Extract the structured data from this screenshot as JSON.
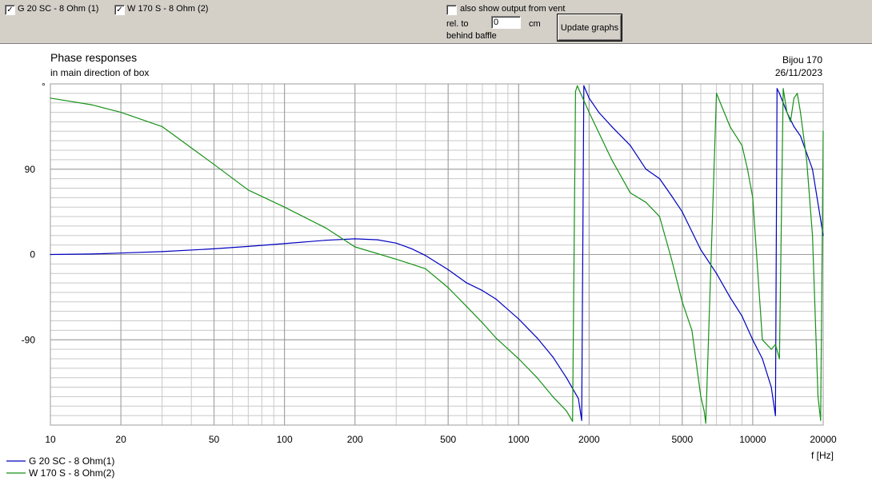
{
  "toolbar": {
    "checkbox1": {
      "label": "G 20 SC - 8 Ohm (1)",
      "checked": true,
      "mark": "✓"
    },
    "checkbox2": {
      "label": "W 170 S - 8 Ohm (2)",
      "checked": true,
      "mark": "✓"
    },
    "vent_checkbox": {
      "label": "also show output from vent",
      "checked": false,
      "mark": ""
    },
    "rel_label": "rel. to",
    "behind_label": "behind baffle",
    "offset_value": "0",
    "unit": "cm",
    "update_button": "Update graphs"
  },
  "colors": {
    "series1": "#0000c0",
    "series2": "#169116",
    "grid_major": "#9c9c9c",
    "grid_minor": "#c8c8c8"
  },
  "chart_data": {
    "type": "line",
    "title": "Phase responses",
    "subtitle": "in main direction of box",
    "project": "Bijou 170",
    "date": "26/11/2023",
    "ylabel_unit": "°",
    "xlabel": "f [Hz]",
    "x_scale": "log",
    "xlim": [
      10,
      20000
    ],
    "ylim": [
      -180,
      180
    ],
    "yticks": [
      90,
      0,
      -90
    ],
    "ytick_labels": [
      "90",
      "0",
      "-90"
    ],
    "xticks": [
      10,
      20,
      50,
      100,
      200,
      500,
      1000,
      2000,
      5000,
      10000,
      20000
    ],
    "xtick_labels": [
      "10",
      "20",
      "50",
      "100",
      "200",
      "500",
      "1000",
      "2000",
      "5000",
      "10000",
      "20000"
    ],
    "grid": true,
    "legend_position": "bottom-left",
    "series": [
      {
        "name": "G 20 SC - 8 Ohm(1)",
        "x": [
          10,
          15,
          20,
          30,
          50,
          70,
          100,
          150,
          200,
          250,
          300,
          350,
          400,
          500,
          600,
          700,
          800,
          1000,
          1200,
          1400,
          1600,
          1800,
          1860,
          1900,
          2000,
          2200,
          2500,
          3000,
          3500,
          4000,
          4500,
          5000,
          6000,
          7000,
          8000,
          9000,
          10000,
          11000,
          12000,
          12500,
          12700,
          13000,
          14000,
          15000,
          16000,
          18000,
          20000
        ],
        "y": [
          0,
          0.5,
          1.5,
          3,
          6,
          8.5,
          11.5,
          15,
          16.5,
          15.5,
          12,
          6,
          -1,
          -16,
          -30,
          -38,
          -47,
          -68,
          -88,
          -108,
          -130,
          -152,
          -175,
          178,
          165,
          150,
          135,
          115,
          90,
          80,
          62,
          45,
          5,
          -20,
          -45,
          -65,
          -90,
          -110,
          -140,
          -170,
          175,
          170,
          150,
          135,
          125,
          90,
          20
        ]
      },
      {
        "name": "W 170 S - 8 Ohm(2)",
        "x": [
          10,
          15,
          20,
          30,
          50,
          70,
          100,
          150,
          200,
          300,
          400,
          500,
          600,
          700,
          800,
          1000,
          1200,
          1400,
          1600,
          1700,
          1750,
          1780,
          2000,
          2500,
          3000,
          3500,
          4000,
          4500,
          5000,
          5500,
          6000,
          6200,
          6300,
          7000,
          8000,
          9000,
          9500,
          10000,
          11000,
          12000,
          12500,
          13000,
          13500,
          14000,
          14500,
          15000,
          15500,
          16000,
          17000,
          18000,
          19000,
          19500,
          20000
        ],
        "y": [
          165,
          158,
          150,
          135,
          95,
          68,
          50,
          28,
          8,
          -5,
          -15,
          -35,
          -55,
          -72,
          -88,
          -110,
          -130,
          -150,
          -165,
          -176,
          172,
          178,
          150,
          100,
          65,
          55,
          40,
          -5,
          -50,
          -80,
          -150,
          -165,
          -178,
          170,
          135,
          115,
          90,
          60,
          -90,
          -100,
          -95,
          -110,
          175,
          150,
          140,
          165,
          170,
          150,
          100,
          20,
          -150,
          -175,
          130
        ]
      }
    ]
  }
}
